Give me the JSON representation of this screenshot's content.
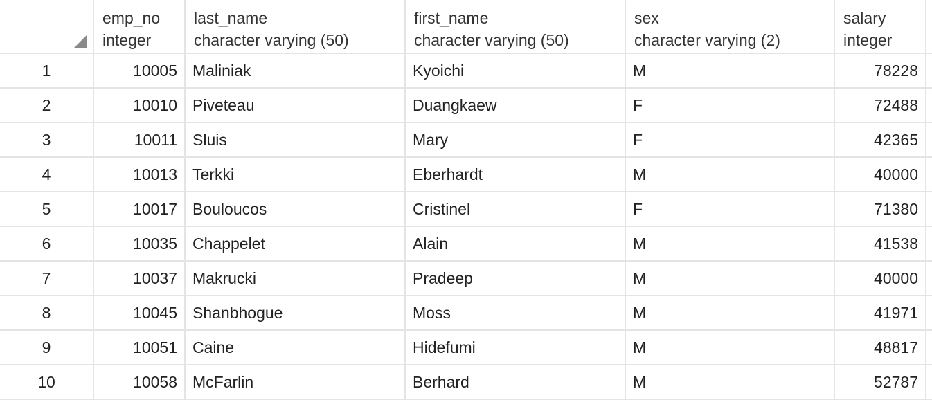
{
  "columns": [
    {
      "name": "emp_no",
      "type": "integer"
    },
    {
      "name": "last_name",
      "type": "character varying (50)"
    },
    {
      "name": "first_name",
      "type": "character varying (50)"
    },
    {
      "name": "sex",
      "type": "character varying (2)"
    },
    {
      "name": "salary",
      "type": "integer"
    }
  ],
  "rows": [
    {
      "num": "1",
      "emp_no": "10005",
      "last_name": "Maliniak",
      "first_name": "Kyoichi",
      "sex": "M",
      "salary": "78228"
    },
    {
      "num": "2",
      "emp_no": "10010",
      "last_name": "Piveteau",
      "first_name": "Duangkaew",
      "sex": "F",
      "salary": "72488"
    },
    {
      "num": "3",
      "emp_no": "10011",
      "last_name": "Sluis",
      "first_name": "Mary",
      "sex": "F",
      "salary": "42365"
    },
    {
      "num": "4",
      "emp_no": "10013",
      "last_name": "Terkki",
      "first_name": "Eberhardt",
      "sex": "M",
      "salary": "40000"
    },
    {
      "num": "5",
      "emp_no": "10017",
      "last_name": "Bouloucos",
      "first_name": "Cristinel",
      "sex": "F",
      "salary": "71380"
    },
    {
      "num": "6",
      "emp_no": "10035",
      "last_name": "Chappelet",
      "first_name": "Alain",
      "sex": "M",
      "salary": "41538"
    },
    {
      "num": "7",
      "emp_no": "10037",
      "last_name": "Makrucki",
      "first_name": "Pradeep",
      "sex": "M",
      "salary": "40000"
    },
    {
      "num": "8",
      "emp_no": "10045",
      "last_name": "Shanbhogue",
      "first_name": "Moss",
      "sex": "M",
      "salary": "41971"
    },
    {
      "num": "9",
      "emp_no": "10051",
      "last_name": "Caine",
      "first_name": "Hidefumi",
      "sex": "M",
      "salary": "48817"
    },
    {
      "num": "10",
      "emp_no": "10058",
      "last_name": "McFarlin",
      "first_name": "Berhard",
      "sex": "M",
      "salary": "52787"
    }
  ],
  "colors": {
    "grid_line": "#e4e4e4",
    "corner_triangle": "#8a8a8a",
    "text": "#222222"
  }
}
